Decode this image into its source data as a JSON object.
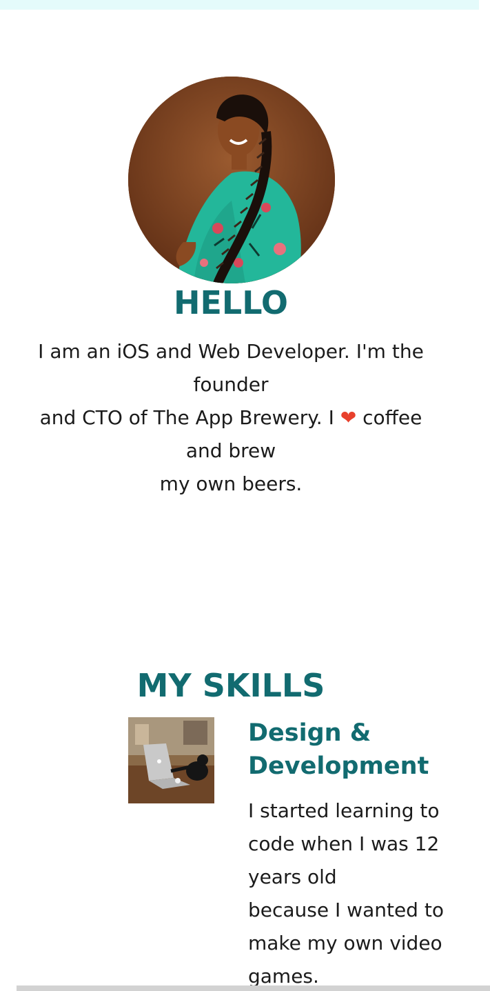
{
  "hero": {
    "heading": "HELLO",
    "intro_lines": [
      "I am an iOS and Web Developer. I'm the",
      "founder",
      "and CTO of The App Brewery. I ",
      " coffee",
      "and brew",
      "my own beers."
    ],
    "heart_symbol": "❤"
  },
  "skills": {
    "heading": "MY SKILLS",
    "item": {
      "title_lines": [
        "Design &",
        "Development"
      ],
      "description_lines": [
        "I started learning to",
        "code when I was 12",
        "years old",
        "because I wanted to",
        "make my own video",
        "games."
      ]
    }
  },
  "colors": {
    "accent": "#126b70",
    "top_band": "#e4fbfb",
    "heart": "#e8402c",
    "text": "#1b1b1b"
  }
}
